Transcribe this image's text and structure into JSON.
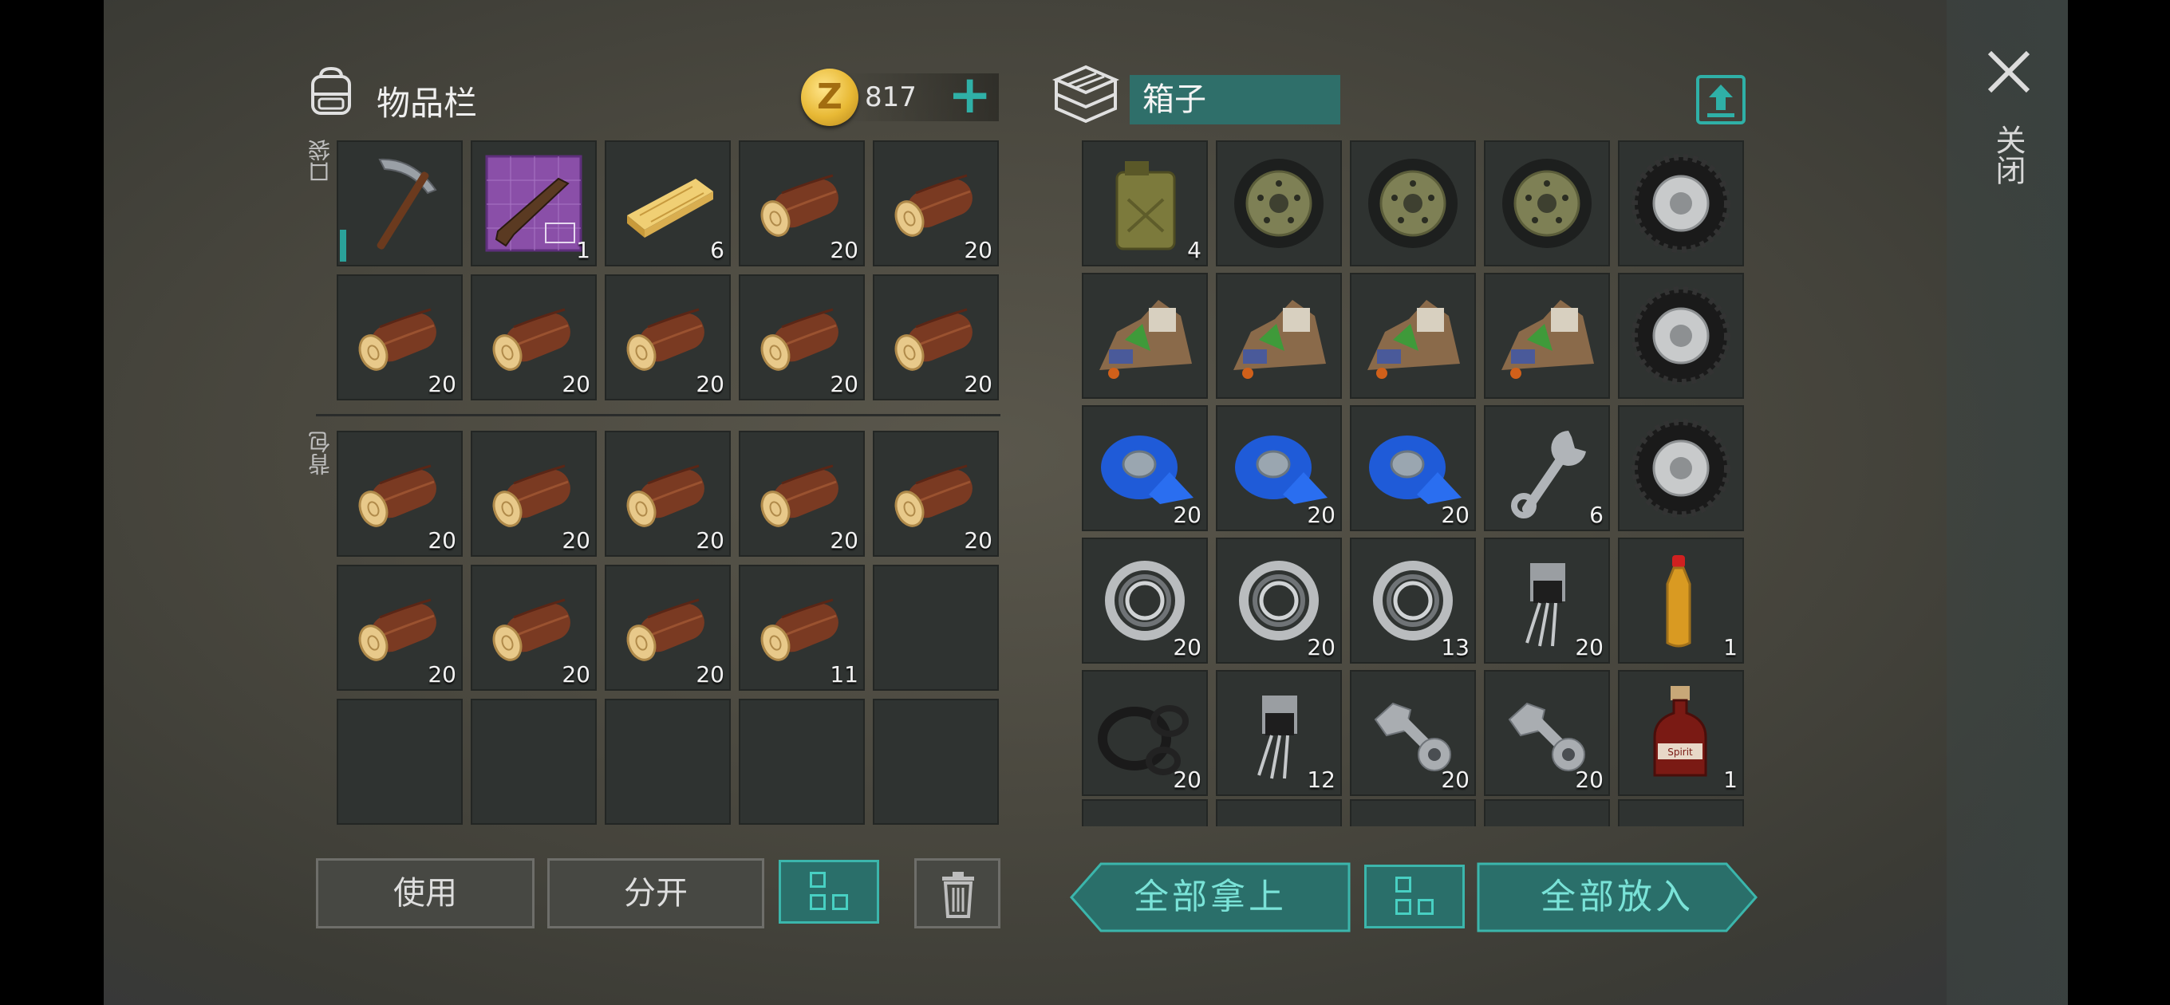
{
  "inventory": {
    "title": "物品栏",
    "pocket_label": "口袋",
    "backpack_label": "背包",
    "coins": "817",
    "coin_symbol": "Z",
    "add_label": "+",
    "pocket": [
      {
        "icon": "pickaxe",
        "qty": ""
      },
      {
        "icon": "rifle-blueprint",
        "qty": "1"
      },
      {
        "icon": "plank",
        "qty": "6"
      },
      {
        "icon": "log",
        "qty": "20"
      },
      {
        "icon": "log",
        "qty": "20"
      },
      {
        "icon": "log",
        "qty": "20"
      },
      {
        "icon": "log",
        "qty": "20"
      },
      {
        "icon": "log",
        "qty": "20"
      },
      {
        "icon": "log",
        "qty": "20"
      },
      {
        "icon": "log",
        "qty": "20"
      }
    ],
    "backpack": [
      {
        "icon": "log",
        "qty": "20"
      },
      {
        "icon": "log",
        "qty": "20"
      },
      {
        "icon": "log",
        "qty": "20"
      },
      {
        "icon": "log",
        "qty": "20"
      },
      {
        "icon": "log",
        "qty": "20"
      },
      {
        "icon": "log",
        "qty": "20"
      },
      {
        "icon": "log",
        "qty": "20"
      },
      {
        "icon": "log",
        "qty": "20"
      },
      {
        "icon": "log",
        "qty": "11"
      },
      {
        "icon": "",
        "qty": ""
      },
      {
        "icon": "",
        "qty": ""
      },
      {
        "icon": "",
        "qty": ""
      },
      {
        "icon": "",
        "qty": ""
      },
      {
        "icon": "",
        "qty": ""
      },
      {
        "icon": "",
        "qty": ""
      }
    ],
    "buttons": {
      "use": "使用",
      "split": "分开"
    }
  },
  "container": {
    "name": "箱子",
    "items": [
      {
        "icon": "jerrycan",
        "qty": "4"
      },
      {
        "icon": "car-wheel",
        "qty": ""
      },
      {
        "icon": "car-wheel",
        "qty": ""
      },
      {
        "icon": "car-wheel",
        "qty": ""
      },
      {
        "icon": "tire",
        "qty": ""
      },
      {
        "icon": "scrap-pile",
        "qty": ""
      },
      {
        "icon": "scrap-pile",
        "qty": ""
      },
      {
        "icon": "scrap-pile",
        "qty": ""
      },
      {
        "icon": "scrap-pile",
        "qty": ""
      },
      {
        "icon": "tire",
        "qty": ""
      },
      {
        "icon": "tape",
        "qty": "20"
      },
      {
        "icon": "tape",
        "qty": "20"
      },
      {
        "icon": "tape",
        "qty": "20"
      },
      {
        "icon": "wrench",
        "qty": "6"
      },
      {
        "icon": "tire",
        "qty": ""
      },
      {
        "icon": "bearing",
        "qty": "20"
      },
      {
        "icon": "bearing",
        "qty": "20"
      },
      {
        "icon": "bearing",
        "qty": "13"
      },
      {
        "icon": "transistor",
        "qty": "20"
      },
      {
        "icon": "bottle",
        "qty": "1"
      },
      {
        "icon": "gaskets",
        "qty": "20"
      },
      {
        "icon": "transistor",
        "qty": "12"
      },
      {
        "icon": "bolt-nut",
        "qty": "20"
      },
      {
        "icon": "bolt-nut",
        "qty": "20"
      },
      {
        "icon": "spirit-bottle",
        "qty": "1"
      }
    ],
    "spirit_label": "Spirit",
    "take_all": "全部拿上",
    "put_all": "全部放入"
  },
  "close_label": "关闭",
  "colors": {
    "accent": "#2fb0a7",
    "slot": "#2f3331",
    "teal_fill": "#2a6f6a"
  }
}
